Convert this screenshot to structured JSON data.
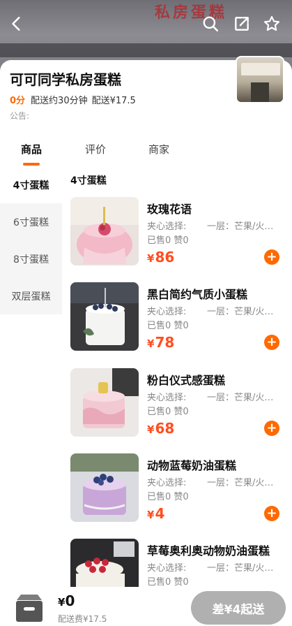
{
  "banner": {
    "sign_text": "私房蛋糕"
  },
  "store": {
    "name": "可可同学私房蛋糕",
    "score": "0分",
    "delivery_time": "配送约30分钟",
    "delivery_fee": "配送¥17.5",
    "notice": "公告:"
  },
  "tabs": [
    "商品",
    "评价",
    "商家"
  ],
  "categories": [
    "4寸蛋糕",
    "6寸蛋糕",
    "8寸蛋糕",
    "双层蛋糕"
  ],
  "section_title": "4寸蛋糕",
  "products": [
    {
      "name": "玫瑰花语",
      "option_label": "夹心选择:",
      "option_value": "一层：芒果/火…",
      "sold": "已售0",
      "likes": "赞0",
      "currency": "¥",
      "price": "86"
    },
    {
      "name": "黑白简约气质小蛋糕",
      "option_label": "夹心选择:",
      "option_value": "一层：芒果/火…",
      "sold": "已售0",
      "likes": "赞0",
      "currency": "¥",
      "price": "78"
    },
    {
      "name": "粉白仪式感蛋糕",
      "option_label": "夹心选择:",
      "option_value": "一层：芒果/火…",
      "sold": "已售0",
      "likes": "赞0",
      "currency": "¥",
      "price": "68"
    },
    {
      "name": "动物蓝莓奶油蛋糕",
      "option_label": "夹心选择:",
      "option_value": "一层：芒果/火…",
      "sold": "已售0",
      "likes": "赞0",
      "currency": "¥",
      "price": "4"
    },
    {
      "name": "草莓奥利奥动物奶油蛋糕",
      "option_label": "夹心选择:",
      "option_value": "一层：芒果/火…",
      "sold": "已售0",
      "likes": "赞0",
      "currency": "¥",
      "price": ""
    }
  ],
  "footer": {
    "currency": "¥",
    "total": "0",
    "fee": "配送费¥17.5",
    "checkout_label": "差¥4起送"
  },
  "icons": [
    "back-icon",
    "search-icon",
    "share-icon",
    "star-icon",
    "cart-icon",
    "plus-icon"
  ],
  "colors": {
    "accent": "#ff6a00",
    "price": "#ff4e1f",
    "disabled_button": "#b0b0b0"
  }
}
